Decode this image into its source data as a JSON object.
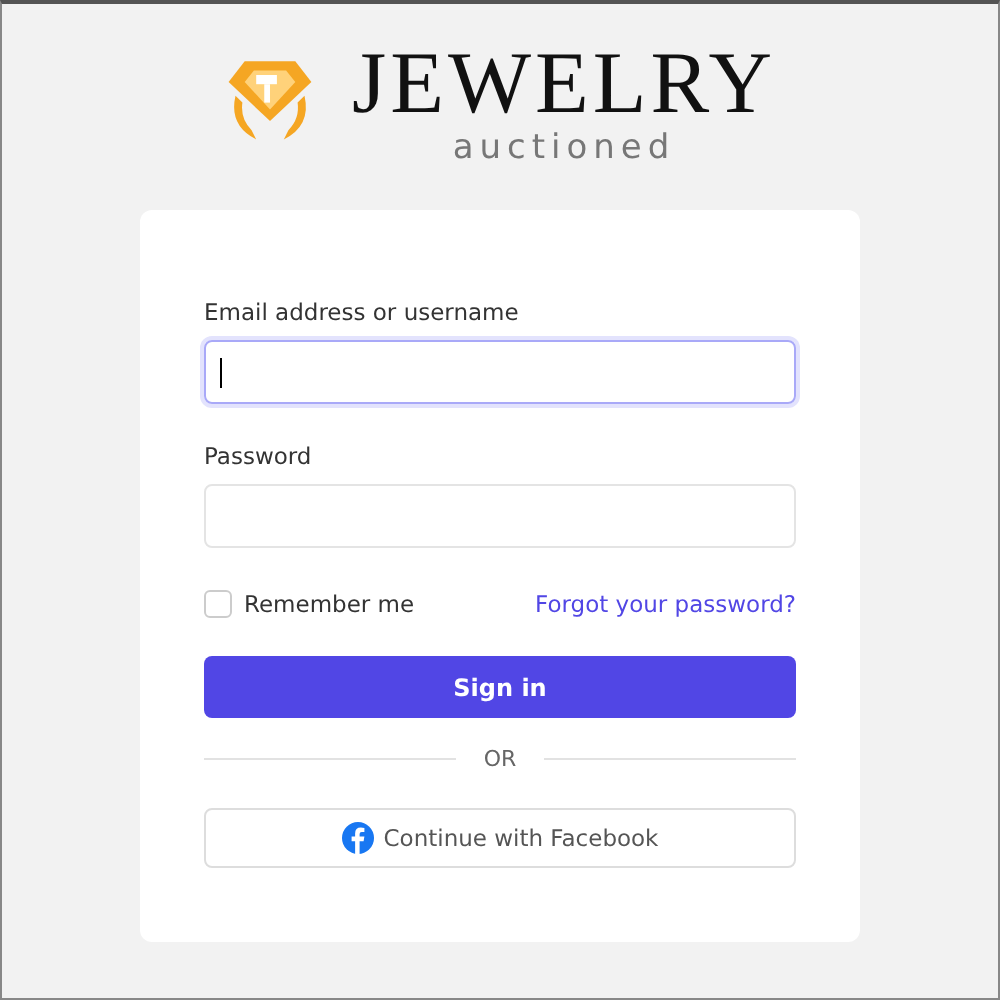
{
  "logo": {
    "title": "JEWELRY",
    "subtitle": "auctioned"
  },
  "form": {
    "fields": [
      {
        "label": "Email address or username",
        "focused": true
      },
      {
        "label": "Password",
        "focused": false
      }
    ],
    "remember": {
      "label": "Remember me",
      "checked": false
    },
    "forgot_link": "Forgot your password?",
    "submit": "Sign in",
    "divider": "OR",
    "facebook_button": "Continue with Facebook"
  }
}
